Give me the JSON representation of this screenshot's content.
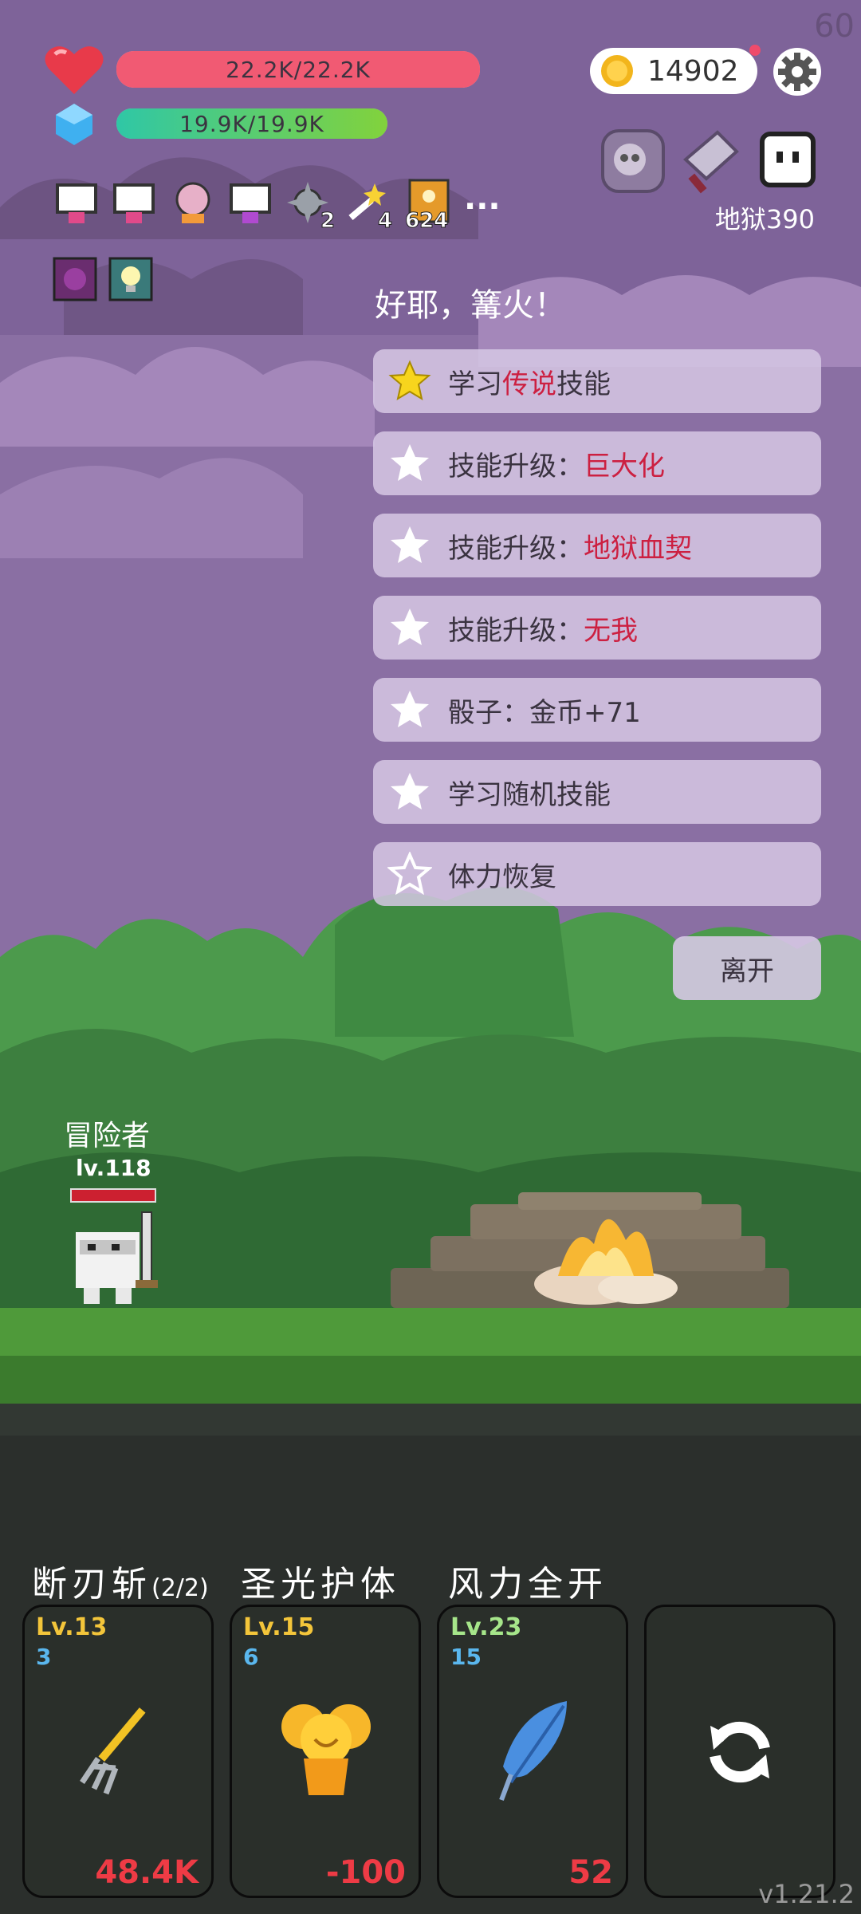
{
  "hud": {
    "fps": "60",
    "hp_text": "22.2K/22.2K",
    "hp_fraction": 1.0,
    "mp_text": "19.9K/19.9K",
    "mp_fraction": 1.0,
    "gold": "14902",
    "relic_counts": [
      "2",
      "4",
      "624"
    ],
    "more": "...",
    "hell_level": "地狱390"
  },
  "event": {
    "title": "好耶，篝火！",
    "options": [
      {
        "prefix": "学习",
        "highlight": "传说",
        "suffix": "技能",
        "star": "gold"
      },
      {
        "prefix": "技能升级：",
        "highlight": "巨大化",
        "suffix": "",
        "star": "white"
      },
      {
        "prefix": "技能升级：",
        "highlight": "地狱血契",
        "suffix": "",
        "star": "white"
      },
      {
        "prefix": "技能升级：",
        "highlight": "无我",
        "suffix": "",
        "star": "white"
      },
      {
        "prefix": "骰子：金币+71",
        "highlight": "",
        "suffix": "",
        "star": "white"
      },
      {
        "prefix": "学习随机技能",
        "highlight": "",
        "suffix": "",
        "star": "white"
      },
      {
        "prefix": "体力恢复",
        "highlight": "",
        "suffix": "",
        "star": "outline"
      }
    ],
    "leave": "离开"
  },
  "hero": {
    "name": "冒险者",
    "level": "lv.118"
  },
  "skills": [
    {
      "name": "断刃斩",
      "charges": "(2/2)",
      "level": "Lv.13",
      "count": "3",
      "value": "48.4K",
      "level_color": "#f3c53a",
      "icon": "pitchfork-icon"
    },
    {
      "name": "圣光护体",
      "charges": "",
      "level": "Lv.15",
      "count": "6",
      "value": "-100",
      "level_color": "#f3c53a",
      "icon": "golden-bell-icon"
    },
    {
      "name": "风力全开",
      "charges": "",
      "level": "Lv.23",
      "count": "15",
      "value": "52",
      "level_color": "#a6e68a",
      "icon": "feather-icon"
    }
  ],
  "refresh_icon": "refresh-icon",
  "version": "v1.21.2",
  "colors": {
    "sky": "#8a6fa3",
    "hp_bar": "#f15a73",
    "mp_bar_start": "#2fc7a6",
    "mp_bar_end": "#82d23c",
    "highlight_red": "#cc2041",
    "skill_value_red": "#ee3b45"
  }
}
